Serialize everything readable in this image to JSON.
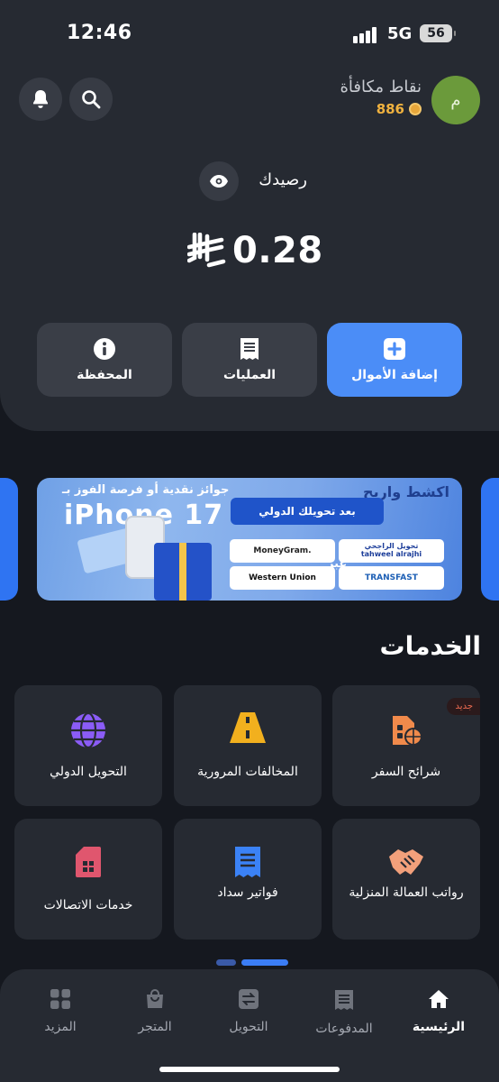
{
  "status_bar": {
    "time": "12:46",
    "network": "5G",
    "battery": "56"
  },
  "header": {
    "avatar_initial": "م",
    "reward_label": "نقاط مكافأة",
    "reward_points": "886"
  },
  "balance": {
    "label": "رصيدك",
    "amount": "0.28",
    "currency_icon": "riyal-symbol-icon"
  },
  "actions": [
    {
      "label": "إضافة الأموال",
      "icon": "plus-icon"
    },
    {
      "label": "العمليات",
      "icon": "receipt-icon"
    },
    {
      "label": "المحفظة",
      "icon": "info-icon"
    }
  ],
  "promo": {
    "headline": "اكشط واربح",
    "after_text": "بعد تحويلك الدولي",
    "win_text": "جوائز نقدية أو فرصة الفوز بـ",
    "phone_text": "iPhone 17",
    "via_text": "عبر",
    "partners": {
      "moneygram": "MoneyGram.",
      "western_union": "Western Union",
      "alrajhi_ar": "تحويل الراجحي",
      "alrajhi_en": "tahweel alrajhi",
      "transfast": "TRANSFAST"
    }
  },
  "services": {
    "title": "الخدمات",
    "new_badge": "جديد",
    "items": [
      {
        "label": "شرائح السفر",
        "icon": "esim-globe-icon",
        "color": "#f08a4b"
      },
      {
        "label": "المخالفات المرورية",
        "icon": "road-icon",
        "color": "#f2b01e"
      },
      {
        "label": "التحويل الدولي",
        "icon": "globe-icon",
        "color": "#8b5cf6"
      },
      {
        "label": "رواتب العمالة المنزلية",
        "icon": "handshake-icon",
        "color": "#f2a07b"
      },
      {
        "label": "فواتير سداد",
        "icon": "bill-icon",
        "color": "#3b82f6"
      },
      {
        "label": "خدمات الاتصالات",
        "icon": "sim-card-icon",
        "color": "#e0566e"
      }
    ]
  },
  "pager": {
    "active_index": 0,
    "count": 2
  },
  "bottom_nav": [
    {
      "label": "الرئيسية",
      "icon": "home-icon",
      "active": true
    },
    {
      "label": "المدفوعات",
      "icon": "payments-icon",
      "active": false
    },
    {
      "label": "التحويل",
      "icon": "transfer-icon",
      "active": false
    },
    {
      "label": "المتجر",
      "icon": "store-icon",
      "active": false
    },
    {
      "label": "المزيد",
      "icon": "grid-icon",
      "active": false
    }
  ],
  "colors": {
    "accent": "#4b8df7",
    "background": "#15181f",
    "card": "#262a32",
    "points": "#f0b23f"
  }
}
